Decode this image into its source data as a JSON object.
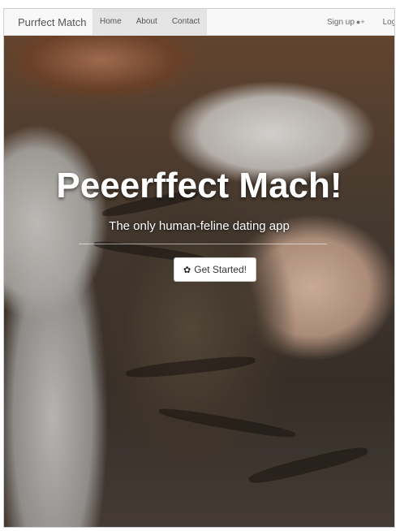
{
  "navbar": {
    "brand": "Purrfect Match",
    "links": [
      "Home",
      "About",
      "Contact"
    ],
    "signup": "Sign up",
    "login": "Login",
    "signup_icon": "add-user-icon",
    "login_icon": "sign-in-icon"
  },
  "hero": {
    "title": "Peeerffect Mach!",
    "subtitle": "The only human-feline dating app",
    "cta_label": "Get Started!",
    "cta_icon": "paw-icon",
    "background": "photo of a tabby cat sleeping in a person's arms"
  },
  "colors": {
    "navbar_bg": "#f8f8f8",
    "nav_active_bg": "#e4e4e4",
    "title_color": "#ffffff"
  }
}
